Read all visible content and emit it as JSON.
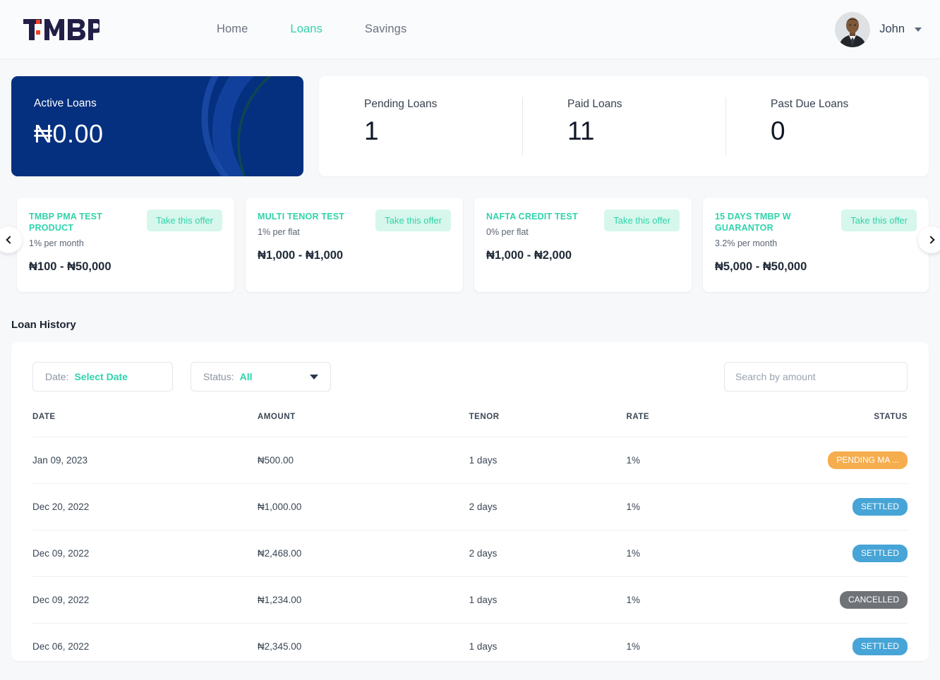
{
  "brand": {
    "name": "TMBP"
  },
  "nav": {
    "items": [
      {
        "label": "Home",
        "active": false
      },
      {
        "label": "Loans",
        "active": true
      },
      {
        "label": "Savings",
        "active": false
      }
    ],
    "accent_color": "#2fd3ab"
  },
  "user": {
    "name": "John",
    "avatar_alt": "user-avatar"
  },
  "stats": {
    "active": {
      "label": "Active Loans",
      "value": "₦0.00",
      "bg_color": "#05307f"
    },
    "cells": [
      {
        "label": "Pending Loans",
        "value": "1"
      },
      {
        "label": "Paid Loans",
        "value": "11"
      },
      {
        "label": "Past Due Loans",
        "value": "0"
      }
    ]
  },
  "offers": {
    "cta_label": "Take this offer",
    "items": [
      {
        "title": "TMBP PMA TEST PRODUCT",
        "rate": "1% per month",
        "range": "₦100 - ₦50,000"
      },
      {
        "title": "MULTI TENOR TEST",
        "rate": "1% per flat",
        "range": "₦1,000 - ₦1,000"
      },
      {
        "title": "NAFTA CREDIT TEST",
        "rate": "0% per flat",
        "range": "₦1,000 - ₦2,000"
      },
      {
        "title": "15 DAYS TMBP W GUARANTOR",
        "rate": "3.2% per month",
        "range": "₦5,000 - ₦50,000"
      }
    ]
  },
  "history": {
    "title": "Loan History",
    "filters": {
      "date_label": "Date:",
      "date_value": "Select Date",
      "status_label": "Status:",
      "status_value": "All"
    },
    "search_placeholder": "Search by amount",
    "search_value": "",
    "columns": [
      "DATE",
      "AMOUNT",
      "TENOR",
      "RATE",
      "STATUS"
    ],
    "rows": [
      {
        "date": "Jan 09, 2023",
        "amount": "₦500.00",
        "tenor": "1 days",
        "rate": "1%",
        "status": "PENDING MA ...",
        "status_kind": "pending"
      },
      {
        "date": "Dec 20, 2022",
        "amount": "₦1,000.00",
        "tenor": "2 days",
        "rate": "1%",
        "status": "SETTLED",
        "status_kind": "settled"
      },
      {
        "date": "Dec 09, 2022",
        "amount": "₦2,468.00",
        "tenor": "2 days",
        "rate": "1%",
        "status": "SETTLED",
        "status_kind": "settled"
      },
      {
        "date": "Dec 09, 2022",
        "amount": "₦1,234.00",
        "tenor": "1 days",
        "rate": "1%",
        "status": "CANCELLED",
        "status_kind": "cancelled"
      },
      {
        "date": "Dec 06, 2022",
        "amount": "₦2,345.00",
        "tenor": "1 days",
        "rate": "1%",
        "status": "SETTLED",
        "status_kind": "settled"
      }
    ],
    "status_colors": {
      "pending": "#f5ad4e",
      "settled": "#47a4d6",
      "cancelled": "#6f7377"
    }
  }
}
